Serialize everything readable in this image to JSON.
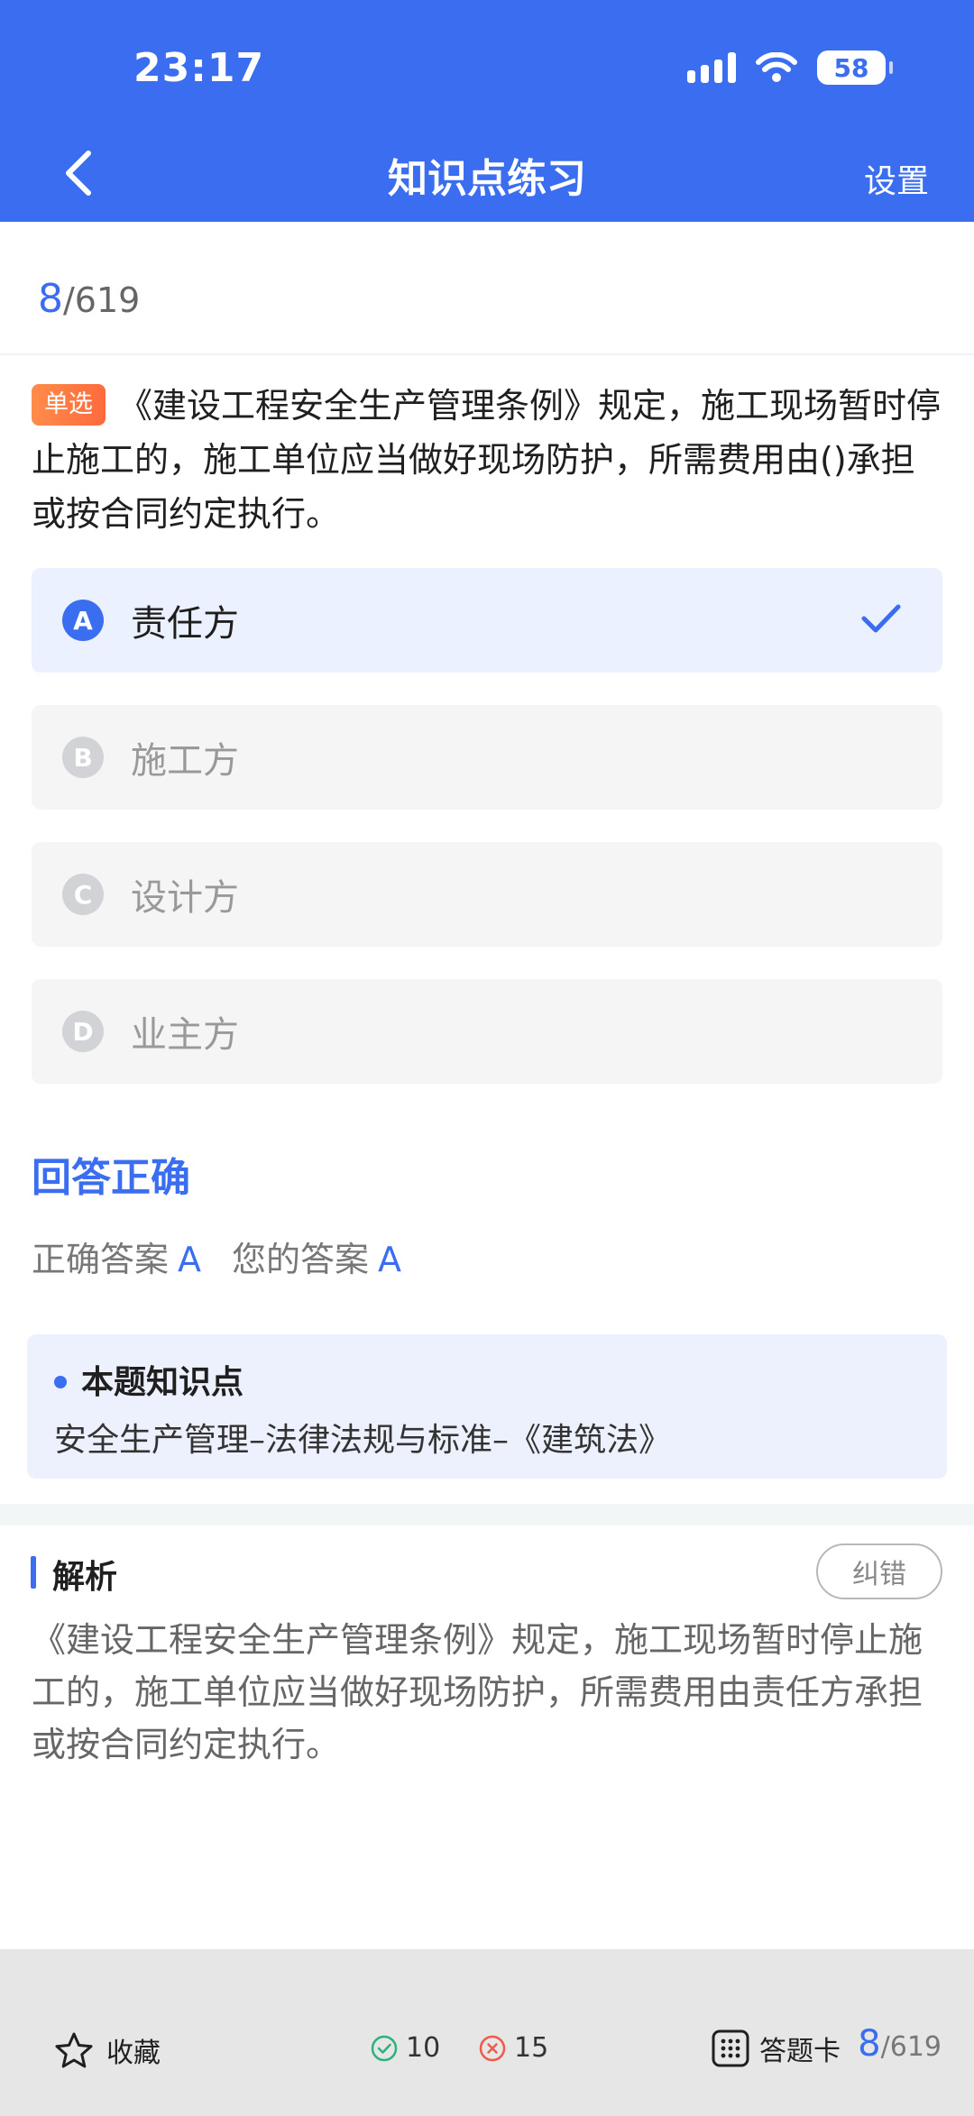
{
  "status_bar": {
    "time": "23:17",
    "battery": "58"
  },
  "nav": {
    "title": "知识点练习",
    "settings_label": "设置"
  },
  "progress": {
    "current": "8",
    "total": "/619"
  },
  "question": {
    "tag": "单选",
    "text": "《建设工程安全生产管理条例》规定，施工现场暂时停止施工的，施工单位应当做好现场防护，所需费用由()承担或按合同约定执行。"
  },
  "options": [
    {
      "letter": "A",
      "text": "责任方",
      "selected": true
    },
    {
      "letter": "B",
      "text": "施工方",
      "selected": false
    },
    {
      "letter": "C",
      "text": "设计方",
      "selected": false
    },
    {
      "letter": "D",
      "text": "业主方",
      "selected": false
    }
  ],
  "result": {
    "title": "回答正确",
    "correct_label": "正确答案",
    "correct_value": "A",
    "your_label": "您的答案",
    "your_value": "A"
  },
  "knowledge": {
    "title": "本题知识点",
    "content": "安全生产管理–法律法规与标准–《建筑法》"
  },
  "analysis": {
    "title": "解析",
    "report_label": "纠错",
    "content": "《建设工程安全生产管理条例》规定，施工现场暂时停止施工的，施工单位应当做好现场防护，所需费用由责任方承担或按合同约定执行。"
  },
  "bottom_bar": {
    "favorite_label": "收藏",
    "correct_count": "10",
    "wrong_count": "15",
    "answer_card_label": "答题卡",
    "progress_current": "8",
    "progress_total": "/619"
  },
  "colors": {
    "primary": "#3a6df0",
    "tag": "#ff7a45",
    "correct": "#2db37a",
    "wrong": "#f05a4a"
  }
}
